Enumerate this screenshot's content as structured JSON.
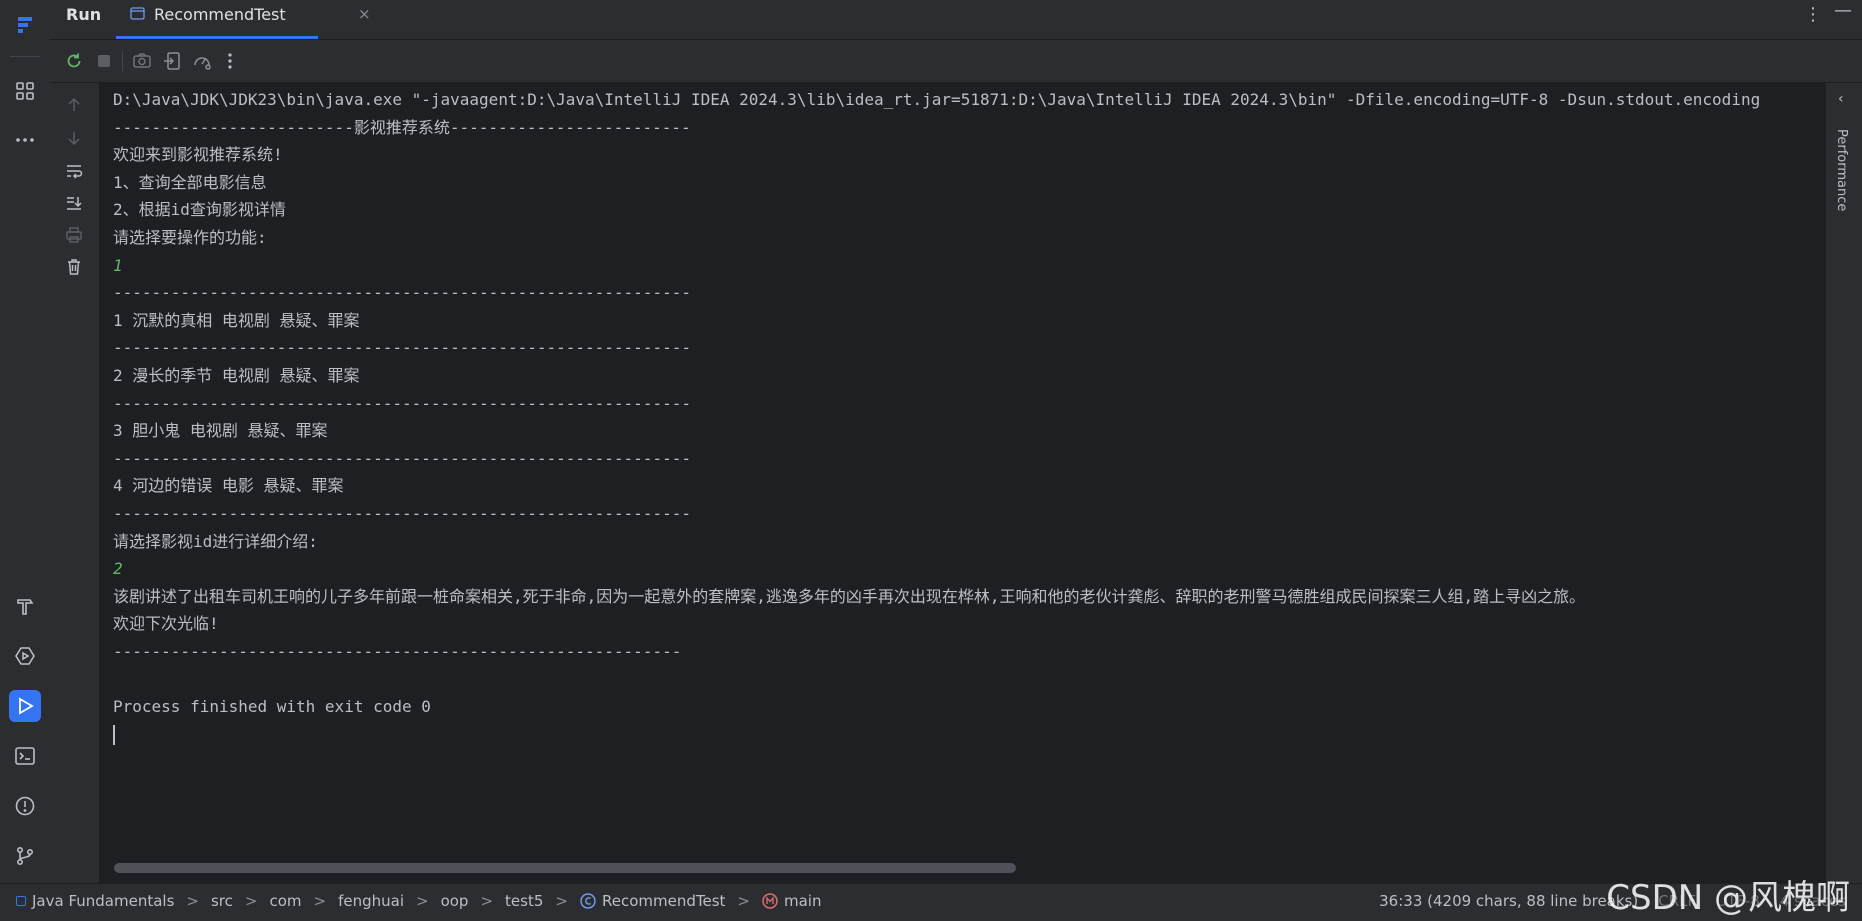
{
  "tabs": {
    "run_label": "Run",
    "config_tab_label": "RecommendTest",
    "close_glyph": "×"
  },
  "icons": {
    "left_strip": [
      "app-logo-icon",
      "project-structure-icon",
      "more-icon",
      "build-icon",
      "services-icon",
      "run-icon",
      "terminal-icon",
      "problems-icon",
      "git-icon"
    ],
    "toolbar": [
      "rerun-icon",
      "stop-icon",
      "screenshot-icon",
      "restore-layout-icon",
      "profiler-icon",
      "more-options-icon"
    ],
    "gutter": [
      "scroll-up-icon",
      "scroll-down-icon",
      "soft-wrap-icon",
      "scroll-to-end-icon",
      "print-icon",
      "clear-all-icon"
    ]
  },
  "console": {
    "lines": [
      {
        "text": "D:\\Java\\JDK\\JDK23\\bin\\java.exe \"-javaagent:D:\\Java\\IntelliJ IDEA 2024.3\\lib\\idea_rt.jar=51871:D:\\Java\\IntelliJ IDEA 2024.3\\bin\" -Dfile.encoding=UTF-8 -Dsun.stdout.encoding",
        "kind": "out"
      },
      {
        "text": "-------------------------影视推荐系统-------------------------",
        "kind": "out"
      },
      {
        "text": "欢迎来到影视推荐系统!",
        "kind": "out"
      },
      {
        "text": "1、查询全部电影信息",
        "kind": "out"
      },
      {
        "text": "2、根据id查询影视详情",
        "kind": "out"
      },
      {
        "text": "请选择要操作的功能:",
        "kind": "out"
      },
      {
        "text": "1",
        "kind": "input"
      },
      {
        "text": "------------------------------------------------------------",
        "kind": "out"
      },
      {
        "text": "1 沉默的真相 电视剧 悬疑、罪案",
        "kind": "out"
      },
      {
        "text": "------------------------------------------------------------",
        "kind": "out"
      },
      {
        "text": "2 漫长的季节 电视剧 悬疑、罪案",
        "kind": "out"
      },
      {
        "text": "------------------------------------------------------------",
        "kind": "out"
      },
      {
        "text": "3 胆小鬼 电视剧 悬疑、罪案",
        "kind": "out"
      },
      {
        "text": "------------------------------------------------------------",
        "kind": "out"
      },
      {
        "text": "4 河边的错误 电影 悬疑、罪案",
        "kind": "out"
      },
      {
        "text": "------------------------------------------------------------",
        "kind": "out"
      },
      {
        "text": "请选择影视id进行详细介绍:",
        "kind": "out"
      },
      {
        "text": "2",
        "kind": "input"
      },
      {
        "text": "该剧讲述了出租车司机王响的儿子多年前跟一桩命案相关,死于非命,因为一起意外的套牌案,逃逸多年的凶手再次出现在桦林,王响和他的老伙计龚彪、辞职的老刑警马德胜组成民间探案三人组,踏上寻凶之旅。",
        "kind": "out"
      },
      {
        "text": "欢迎下次光临!",
        "kind": "out"
      },
      {
        "text": "-----------------------------------------------------------",
        "kind": "out"
      },
      {
        "text": "",
        "kind": "out"
      },
      {
        "text": "Process finished with exit code 0",
        "kind": "out"
      }
    ]
  },
  "right_panel": {
    "performance_label": "Performance"
  },
  "statusbar": {
    "breadcrumbs": [
      "Java Fundamentals",
      "src",
      "com",
      "fenghuai",
      "oop",
      "test5",
      "RecommendTest",
      "main"
    ],
    "separator": ">",
    "position": "36:33 (4209 chars, 88 line breaks)",
    "line_ending": "CRLF",
    "encoding": "UTF-8",
    "indent": "4 spaces"
  },
  "watermark": "CSDN @风槐啊",
  "colors": {
    "accent": "#3574f0",
    "input_text": "#5fb865",
    "background": "#1e1f22",
    "panel": "#2b2d30"
  }
}
